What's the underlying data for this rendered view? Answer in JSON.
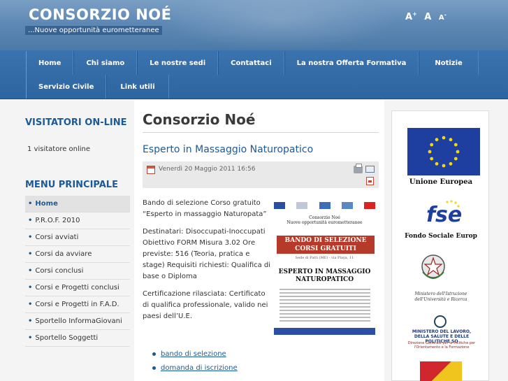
{
  "header": {
    "site_title": "CONSORZIO NOÉ",
    "tagline": "...Nuove opportunità eurometteranee",
    "font_controls": [
      "A+",
      "A",
      "A-"
    ]
  },
  "nav": {
    "row1": [
      "Home",
      "Chi siamo",
      "Le nostre sedi",
      "Contattaci",
      "La nostra Offerta Formativa",
      "Notizie"
    ],
    "row2": [
      "Servizio Civile",
      "Link utili"
    ]
  },
  "sidebar": {
    "visitors_heading": "VISITATORI ON-LINE",
    "visitors_text": "1 visitatore online",
    "menu_heading": "MENU PRINCIPALE",
    "menu_items": [
      {
        "label": "Home",
        "active": true
      },
      {
        "label": "P.R.O.F. 2010",
        "active": false
      },
      {
        "label": "Corsi avviati",
        "active": false
      },
      {
        "label": "Corsi da avviare",
        "active": false
      },
      {
        "label": "Corsi conclusi",
        "active": false
      },
      {
        "label": "Corsi e Progetti conclusi",
        "active": false
      },
      {
        "label": "Corsi e Progetti in F.A.D.",
        "active": false
      },
      {
        "label": "Sportello InformaGiovani",
        "active": false
      },
      {
        "label": "Sportello Soggetti",
        "active": false
      }
    ]
  },
  "main": {
    "page_title": "Consorzio Noé",
    "article_title": "Esperto in Massaggio Naturopatico",
    "date": "Venerdì 20 Maggio 2011 16:56",
    "body": [
      "Bando di selezione Corso gratuito “Esperto in massaggio Naturopata”",
      "Destinatari: Disoccupati-Inoccupati Obiettivo FORM Misura 3.02 Ore previste: 516 (Teoria, pratica e stage) Requisiti richiesti: Qualifica di base o Diploma",
      "Certificazione rilasciata: Certificato di qualifica professionale, valido nei paesi dell’U.E."
    ],
    "links": [
      "bando di selezione",
      "domanda di iscrizione"
    ]
  },
  "flyer": {
    "org": "Consorzio Noé\nNuove opportunità eurometteranee",
    "banner": "BANDO DI SELEZIONE CORSI GRATUITI",
    "contacts": "Sede di Patti (ME) - via Playa, 11",
    "course": "ESPERTO IN MASSAGGIO NATUROPATICO"
  },
  "right_col": {
    "eu_label": "Unione Europea",
    "fse_label": "Fondo Sociale Europ",
    "miur_label": "Ministero dell'Istruzione dell'Università e Ricerca",
    "ministry_label": "MINISTERO DEL LAVORO, DELLA SALUTE E DELLE POLITICHE SO",
    "ministry_sub": "Direzione Generale per le Politiche per l'Orientamento e la Formazione"
  },
  "colors": {
    "header_blue": "#5f89b5",
    "nav_blue": "#2d65a0",
    "link_blue": "#1b5a97",
    "eu_blue": "#1e3ea0"
  }
}
